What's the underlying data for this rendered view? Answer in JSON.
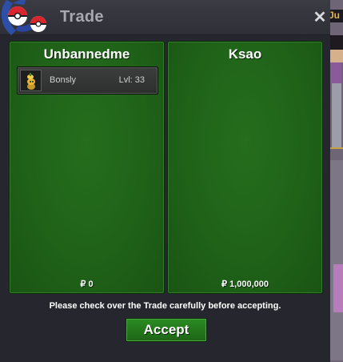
{
  "window": {
    "title": "Trade",
    "close_label": "✕"
  },
  "background": {
    "side_label": "Ju"
  },
  "left_panel": {
    "player_name": "Unbannedme",
    "items": [
      {
        "icon": "bonsly-icon",
        "name": "Bonsly",
        "level": "Lvl: 33"
      }
    ],
    "money": "₽ 0"
  },
  "right_panel": {
    "player_name": "Ksao",
    "items": [],
    "money": "₽ 1,000,000"
  },
  "notice": "Please check over the Trade carefully before accepting.",
  "accept_label": "Accept",
  "colors": {
    "panel_green": "#1f6218",
    "accept_green": "#2b8c22",
    "window_bg": "#2c2d34",
    "title_text": "#a8a9b0"
  }
}
